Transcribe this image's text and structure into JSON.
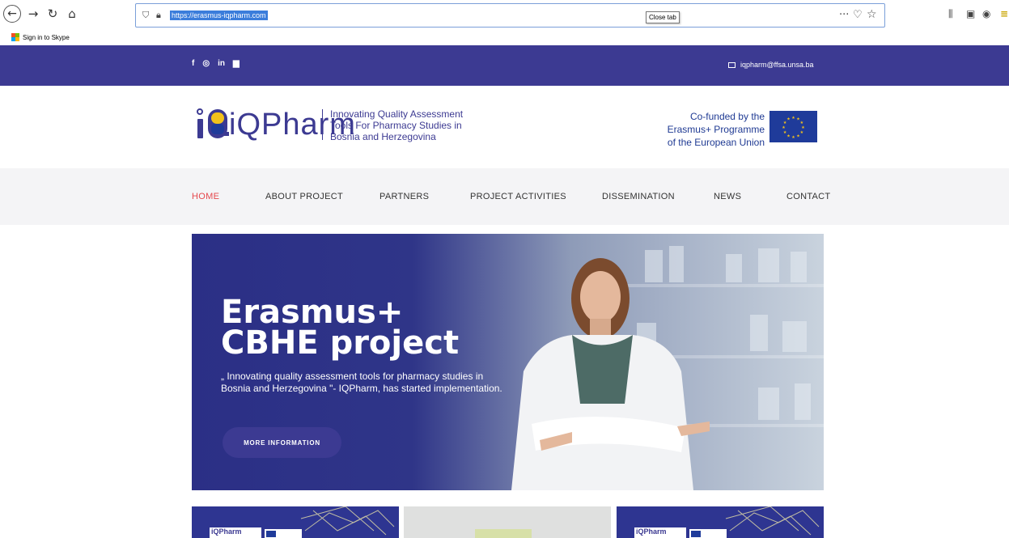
{
  "browser": {
    "url": "https://erasmus-iqpharm.com",
    "close_tab_tooltip": "Close tab",
    "more_icon": "···",
    "bookmark_label": "Sign in to Skype"
  },
  "site": {
    "social": [
      "f",
      "◎",
      "in",
      "▆"
    ],
    "email": "iqpharm@ffsa.unsa.ba",
    "logo": {
      "word": "iQPharm",
      "tagline": [
        "Innovating Quality Assessment",
        "Tools For Pharmacy Studies in",
        "Bosnia and Herzegovina"
      ]
    },
    "cofunded": [
      "Co-funded by the",
      "Erasmus+ Programme",
      "of the European Union"
    ],
    "nav": [
      {
        "label": "HOME",
        "active": true
      },
      {
        "label": "ABOUT PROJECT"
      },
      {
        "label": "PARTNERS"
      },
      {
        "label": "PROJECT ACTIVITIES"
      },
      {
        "label": "DISSEMINATION"
      },
      {
        "label": "NEWS"
      },
      {
        "label": "CONTACT"
      }
    ],
    "hero": {
      "title_line1": "Erasmus+",
      "title_line2": "CBHE project",
      "text": "„ Innovating quality assessment tools for pharmacy studies in Bosnia and Herzegovina \"- IQPharm, has started implementation.",
      "button": "MORE INFORMATION"
    },
    "cards": [
      {
        "logo": "iQPharm"
      },
      {},
      {
        "logo": "iQPharm"
      }
    ]
  },
  "colors": {
    "brand": "#3c3a92",
    "nav_active": "#e5484d",
    "nav_bg": "#f4f4f6",
    "eu_blue": "#1f3b9a"
  }
}
